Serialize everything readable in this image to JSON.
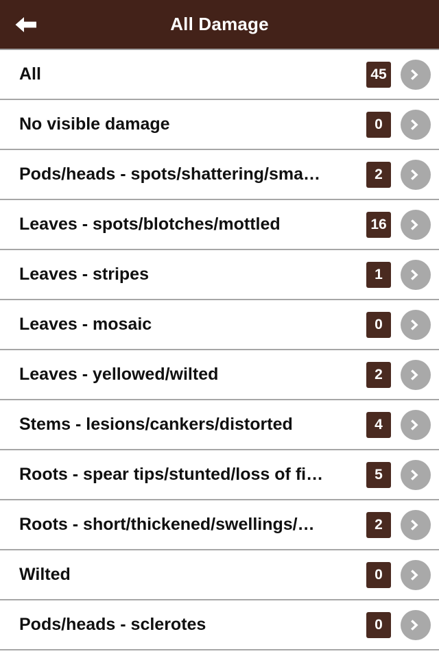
{
  "header": {
    "title": "All Damage",
    "back_icon": "arrow-left-icon",
    "background_color": "#432219",
    "title_color": "#ffffff"
  },
  "theme": {
    "accent_brown": "#432219",
    "badge_brown": "#4a2a20",
    "chevron_gray": "#a9a9a9",
    "separator_gray": "#a6a6a6",
    "row_background": "#ffffff",
    "label_color": "#101010"
  },
  "list": {
    "chevron_icon": "chevron-right-icon",
    "items": [
      {
        "label": "All",
        "count": "45"
      },
      {
        "label": "No visible damage",
        "count": "0"
      },
      {
        "label": "Pods/heads - spots/shattering/sma…",
        "count": "2"
      },
      {
        "label": "Leaves - spots/blotches/mottled",
        "count": "16"
      },
      {
        "label": "Leaves - stripes",
        "count": "1"
      },
      {
        "label": "Leaves - mosaic",
        "count": "0"
      },
      {
        "label": "Leaves - yellowed/wilted",
        "count": "2"
      },
      {
        "label": "Stems - lesions/cankers/distorted",
        "count": "4"
      },
      {
        "label": "Roots - spear tips/stunted/loss of fi…",
        "count": "5"
      },
      {
        "label": "Roots - short/thickened/swellings/…",
        "count": "2"
      },
      {
        "label": "Wilted",
        "count": "0"
      },
      {
        "label": "Pods/heads - sclerotes",
        "count": "0"
      }
    ]
  }
}
